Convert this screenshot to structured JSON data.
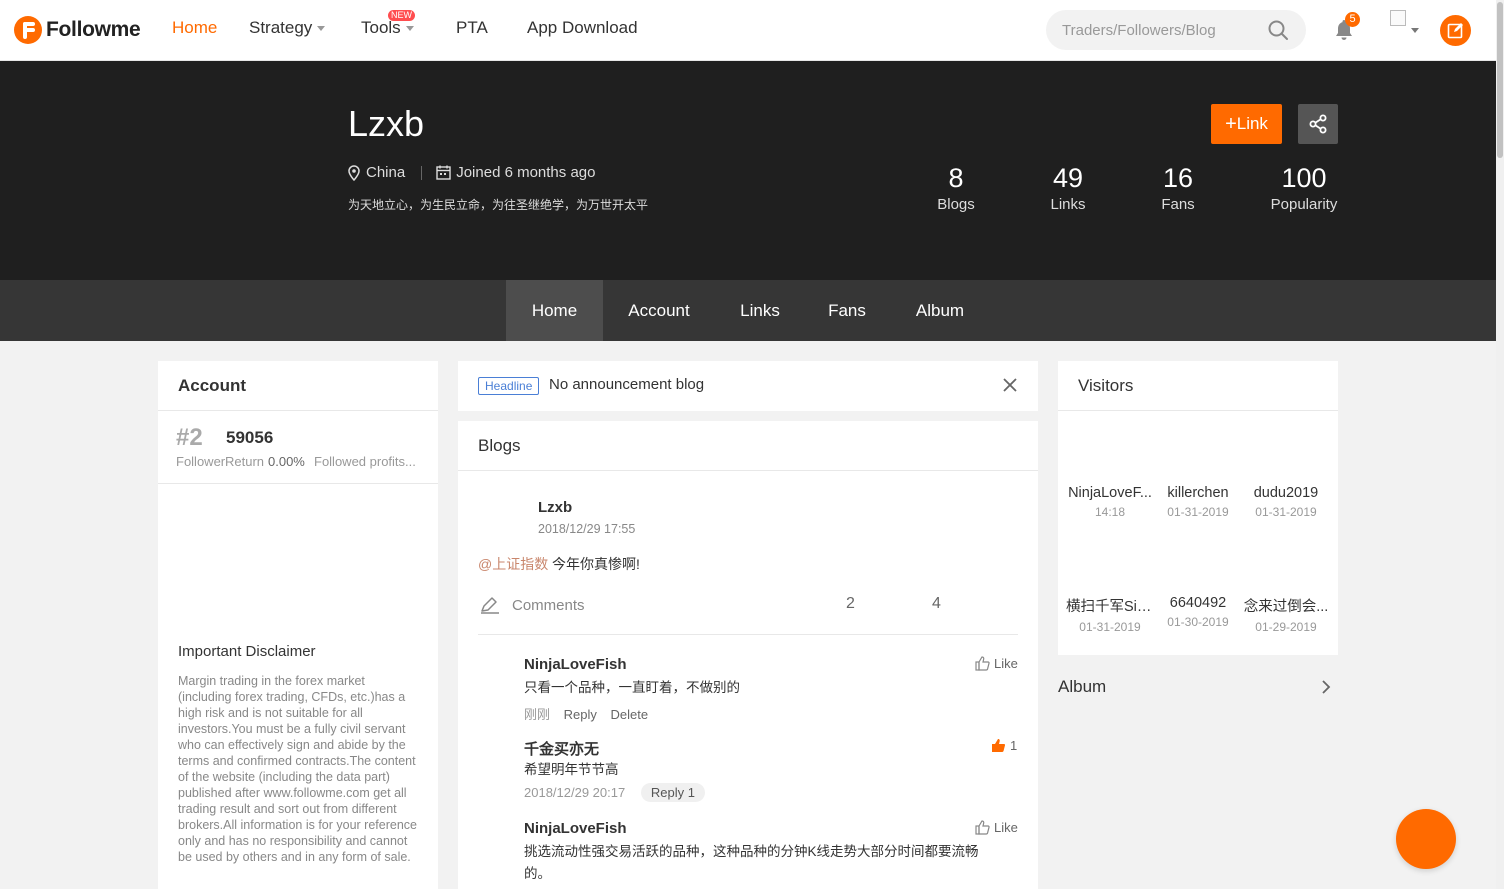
{
  "nav": {
    "logo_text": "Followme",
    "items": [
      "Home",
      "Strategy",
      "Tools",
      "PTA",
      "App Download"
    ],
    "new_badge": "NEW",
    "search_placeholder": "Traders/Followers/Blog",
    "notification_count": "5",
    "accent_color": "#ff6a00"
  },
  "profile": {
    "name": "Lzxb",
    "location": "China",
    "joined": "Joined 6 months ago",
    "motto": "为天地立心，为生民立命，为往圣继绝学，为万世开太平",
    "link_button": "Link",
    "stats": [
      {
        "value": "8",
        "label": "Blogs"
      },
      {
        "value": "49",
        "label": "Links"
      },
      {
        "value": "16",
        "label": "Fans"
      },
      {
        "value": "100",
        "label": "Popularity"
      }
    ]
  },
  "tabs": [
    "Home",
    "Account",
    "Links",
    "Fans",
    "Album"
  ],
  "account": {
    "title": "Account",
    "rank": "#2",
    "number": "59056",
    "sub1": "Follower",
    "sub2": "Return",
    "sub3": "0.00%",
    "sub4": "Followed profits...",
    "disclaimer_title": "Important Disclaimer",
    "disclaimer_body": "Margin trading in the forex market (including forex trading, CFDs, etc.)has a high risk and is not suitable for all investors.You must be a fully civil servant who can effectively sign and abide by the terms and confirmed contracts.The content of the website (including the data part) published after www.followme.com get all trading result and sort out from different brokers.All information is for your reference only and has no responsibility and cannot be used by others and in any form of sale."
  },
  "headline": {
    "tag": "Headline",
    "text": "No announcement blog"
  },
  "blogs": {
    "title": "Blogs",
    "post": {
      "author": "Lzxb",
      "time": "2018/12/29 17:55",
      "mention": "@上证指数",
      "text": "今年你真惨啊!",
      "comments_label": "Comments",
      "count_a": "2",
      "count_b": "4"
    },
    "comments": [
      {
        "name": "NinjaLoveFish",
        "text": "只看一个品种，一直盯着，不做别的",
        "time": "刚刚",
        "reply": "Reply",
        "delete": "Delete",
        "like": "Like"
      },
      {
        "name": "千金买亦无",
        "text": "希望明年节节高",
        "time": "2018/12/29 20:17",
        "reply": "Reply 1",
        "like": "1"
      },
      {
        "name": "NinjaLoveFish",
        "text": "挑选流动性强交易活跃的品种，这种品种的分钟K线走势大部分时间都要流畅的。",
        "like": "Like"
      }
    ]
  },
  "visitors": {
    "title": "Visitors",
    "list": [
      {
        "name": "NinjaLoveF...",
        "time": "14:18"
      },
      {
        "name": "killerchen",
        "time": "01-31-2019"
      },
      {
        "name": "dudu2019",
        "time": "01-31-2019"
      },
      {
        "name": "横扫千军Sin...",
        "time": "01-31-2019"
      },
      {
        "name": "6640492",
        "time": "01-30-2019"
      },
      {
        "name": "念来过倒会...",
        "time": "01-29-2019"
      }
    ]
  },
  "album": {
    "title": "Album"
  }
}
